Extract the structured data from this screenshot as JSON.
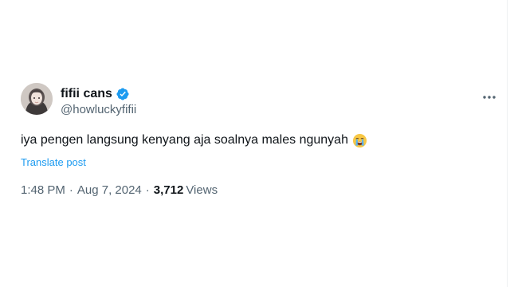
{
  "tweet": {
    "display_name": "fifii cans",
    "handle": "@howluckyfifii",
    "text": "iya pengen langsung kenyang aja soalnya males ngunyah",
    "emoji_icon": "loudly-crying-face-emoji",
    "translate_label": "Translate post",
    "time": "1:48 PM",
    "separator": "·",
    "date": "Aug 7, 2024",
    "views_count": "3,712",
    "views_label": "Views"
  },
  "icons": {
    "verified": "verified-badge-icon",
    "more": "more-horizontal-icon"
  },
  "colors": {
    "text_primary": "#0f1419",
    "text_secondary": "#536471",
    "accent": "#1d9bf0",
    "background": "#ffffff"
  }
}
